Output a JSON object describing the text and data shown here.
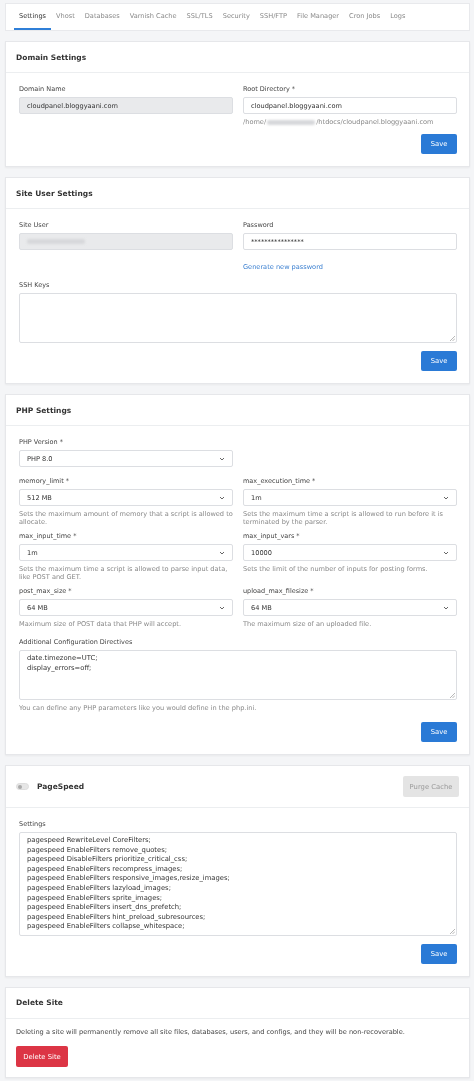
{
  "tabs": [
    {
      "label": "Settings",
      "selected": true
    },
    {
      "label": "Vhost",
      "selected": false
    },
    {
      "label": "Databases",
      "selected": false
    },
    {
      "label": "Varnish Cache",
      "selected": false
    },
    {
      "label": "SSL/TLS",
      "selected": false
    },
    {
      "label": "Security",
      "selected": false
    },
    {
      "label": "SSH/FTP",
      "selected": false
    },
    {
      "label": "File Manager",
      "selected": false
    },
    {
      "label": "Cron Jobs",
      "selected": false
    },
    {
      "label": "Logs",
      "selected": false
    }
  ],
  "domain_settings": {
    "title": "Domain Settings",
    "domain_name": {
      "label": "Domain Name",
      "value": "cloudpanel.bloggyaani.com",
      "disabled": true
    },
    "root_directory": {
      "label": "Root Directory *",
      "value": "cloudpanel.bloggyaani.com",
      "path_prefix": "/home/",
      "path_suffix": "/htdocs/cloudpanel.bloggyaani.com"
    },
    "save": "Save"
  },
  "site_user_settings": {
    "title": "Site User Settings",
    "site_user": {
      "label": "Site User",
      "disabled": true
    },
    "password": {
      "label": "Password",
      "value": "****************",
      "link": "Generate new password"
    },
    "ssh_keys": {
      "label": "SSH Keys"
    },
    "save": "Save"
  },
  "php_settings": {
    "title": "PHP Settings",
    "php_version": {
      "label": "PHP Version *",
      "value": "PHP 8.0"
    },
    "fields": [
      {
        "label": "memory_limit *",
        "value": "512 MB",
        "hint": "Sets the maximum amount of memory that a script is allowed to allocate."
      },
      {
        "label": "max_execution_time *",
        "value": "1m",
        "hint": "Sets the maximum time a script is allowed to run before it is terminated by the parser."
      },
      {
        "label": "max_input_time *",
        "value": "1m",
        "hint": "Sets the maximum time a script is allowed to parse input data, like POST and GET."
      },
      {
        "label": "max_input_vars *",
        "value": "10000",
        "hint": "Sets the limit of the number of inputs for posting forms."
      },
      {
        "label": "post_max_size *",
        "value": "64 MB",
        "hint": "Maximum size of POST data that PHP will accept."
      },
      {
        "label": "upload_max_filesize *",
        "value": "64 MB",
        "hint": "The maximum size of an uploaded file."
      }
    ],
    "directives": {
      "label": "Additional Configuration Directives",
      "lines": [
        "date.timezone=UTC;",
        "display_errors=off;"
      ],
      "hint": "You can define any PHP parameters like you would define in the php.ini."
    },
    "save": "Save"
  },
  "pagespeed": {
    "title": "PageSpeed",
    "on": false,
    "purge_cache": {
      "label": "Purge Cache",
      "disabled": true
    },
    "settings": {
      "label": "Settings",
      "lines": [
        "pagespeed RewriteLevel CoreFilters;",
        "pagespeed EnableFilters remove_quotes;",
        "pagespeed DisableFilters prioritize_critical_css;",
        "pagespeed EnableFilters recompress_images;",
        "pagespeed EnableFilters responsive_images,resize_images;",
        "pagespeed EnableFilters lazyload_images;",
        "pagespeed EnableFilters sprite_images;",
        "pagespeed EnableFilters insert_dns_prefetch;",
        "pagespeed EnableFilters hint_preload_subresources;",
        "pagespeed EnableFilters collapse_whitespace;"
      ]
    },
    "save": "Save"
  },
  "delete_site": {
    "title": "Delete Site",
    "text": "Deleting a site will permanently remove all site files, databases, users, and configs, and they will be non-recoverable.",
    "button": "Delete Site"
  }
}
